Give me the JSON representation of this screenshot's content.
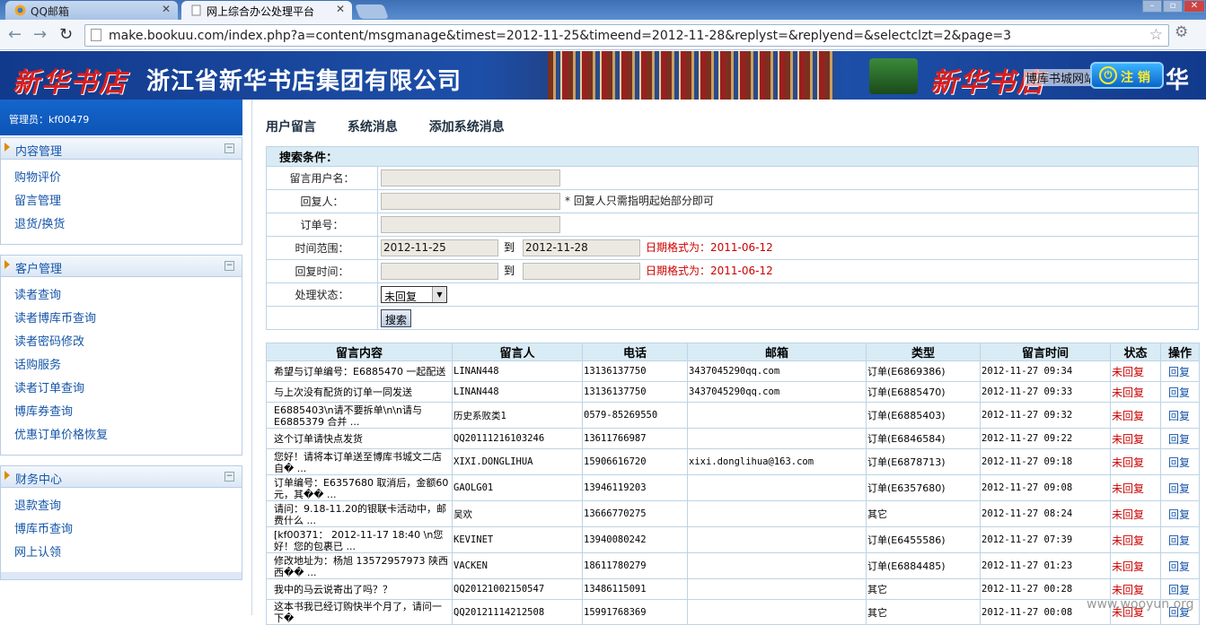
{
  "browser": {
    "tabs": [
      {
        "label": "QQ邮箱",
        "active": false
      },
      {
        "label": "网上综合办公处理平台",
        "active": true
      }
    ],
    "url": "make.bookuu.com/index.php?a=content/msgmanage&timest=2012-11-25&timeend=2012-11-28&replyst=&replyend=&selectclzt=2&page=3"
  },
  "banner": {
    "logo_text": "新华书店",
    "company": "浙江省新华书店集团有限公司",
    "site_label": "博库书城网站",
    "logout_label": "注 销",
    "tail_text": "华书"
  },
  "sidebar": {
    "admin_label": "管理员：kf00479",
    "sections": [
      {
        "title": "内容管理",
        "items": [
          "购物评价",
          "留言管理",
          "退货/换货"
        ]
      },
      {
        "title": "客户管理",
        "items": [
          "读者查询",
          "读者博库币查询",
          "读者密码修改",
          "话购服务",
          "读者订单查询",
          "博库券查询",
          "优惠订单价格恢复"
        ]
      },
      {
        "title": "财务中心",
        "items": [
          "退款查询",
          "博库币查询",
          "网上认领"
        ]
      }
    ]
  },
  "topnav": [
    "用户留言",
    "系统消息",
    "添加系统消息"
  ],
  "search": {
    "caption": "搜索条件：",
    "user_label": "留言用户名：",
    "user_value": "",
    "replier_label": "回复人：",
    "replier_value": "",
    "replier_note": "* 回复人只需指明起始部分即可",
    "order_label": "订单号：",
    "order_value": "",
    "time_label": "时间范围：",
    "time_start": "2012-11-25",
    "to": "到",
    "time_end": "2012-11-28",
    "date_format_note": "日期格式为：2011-06-12",
    "reply_time_label": "回复时间：",
    "reply_start": "",
    "reply_end": "",
    "status_label": "处理状态：",
    "status_value": "未回复",
    "search_button": "搜索"
  },
  "table": {
    "headers": [
      "留言内容",
      "留言人",
      "电话",
      "邮箱",
      "类型",
      "留言时间",
      "状态",
      "操作"
    ],
    "rows": [
      {
        "content": "希望与订单编号：E6885470 一起配送",
        "user": "LINAN448",
        "phone": "13136137750",
        "email": "3437045290qq.com",
        "type": "订单(E6869386)",
        "time": "2012-11-27 09:34",
        "status": "未回复",
        "op": "回复"
      },
      {
        "content": "与上次没有配货的订单一同发送",
        "user": "LINAN448",
        "phone": "13136137750",
        "email": "3437045290qq.com",
        "type": "订单(E6885470)",
        "time": "2012-11-27 09:33",
        "status": "未回复",
        "op": "回复"
      },
      {
        "content": "E6885403\\n请不要拆单\\n\\n请与E6885379 合并 ...",
        "user": "历史系败类1",
        "phone": "0579-85269550",
        "email": "",
        "type": "订单(E6885403)",
        "time": "2012-11-27 09:32",
        "status": "未回复",
        "op": "回复"
      },
      {
        "content": "这个订单请快点发货",
        "user": "QQ20111216103246",
        "phone": "13611766987",
        "email": "",
        "type": "订单(E6846584)",
        "time": "2012-11-27 09:22",
        "status": "未回复",
        "op": "回复"
      },
      {
        "content": "您好！请将本订单送至博库书城文二店自� ...",
        "user": "XIXI.DONGLIHUA",
        "phone": "15906616720",
        "email": "xixi.donglihua@163.com",
        "type": "订单(E6878713)",
        "time": "2012-11-27 09:18",
        "status": "未回复",
        "op": "回复"
      },
      {
        "content": "订单编号：E6357680 取消后，金额60元，其�� ...",
        "user": "GAOLG01",
        "phone": "13946119203",
        "email": "",
        "type": "订单(E6357680)",
        "time": "2012-11-27 09:08",
        "status": "未回复",
        "op": "回复"
      },
      {
        "content": "请问：9.18-11.20的银联卡活动中，邮费什么 ...",
        "user": "吴欢",
        "phone": "13666770275",
        "email": "",
        "type": "其它",
        "time": "2012-11-27 08:24",
        "status": "未回复",
        "op": "回复"
      },
      {
        "content": "[kf00371： 2012-11-17 18:40 \\n您好！您的包裹已 ...",
        "user": "KEVINET",
        "phone": "13940080242",
        "email": "",
        "type": "订单(E6455586)",
        "time": "2012-11-27 07:39",
        "status": "未回复",
        "op": "回复"
      },
      {
        "content": "修改地址为：杨旭 13572957973 陕西西�� ...",
        "user": "VACKEN",
        "phone": "18611780279",
        "email": "",
        "type": "订单(E6884485)",
        "time": "2012-11-27 01:23",
        "status": "未回复",
        "op": "回复"
      },
      {
        "content": "我中的马云说寄出了吗？？",
        "user": "QQ20121002150547",
        "phone": "13486115091",
        "email": "",
        "type": "其它",
        "time": "2012-11-27 00:28",
        "status": "未回复",
        "op": "回复"
      },
      {
        "content": "这本书我已经订购快半个月了，请问一下�",
        "user": "QQ20121114212508",
        "phone": "15991768369",
        "email": "",
        "type": "其它",
        "time": "2012-11-27 00:08",
        "status": "未回复",
        "op": "回复"
      }
    ]
  },
  "watermark": "www.wooyun.org"
}
